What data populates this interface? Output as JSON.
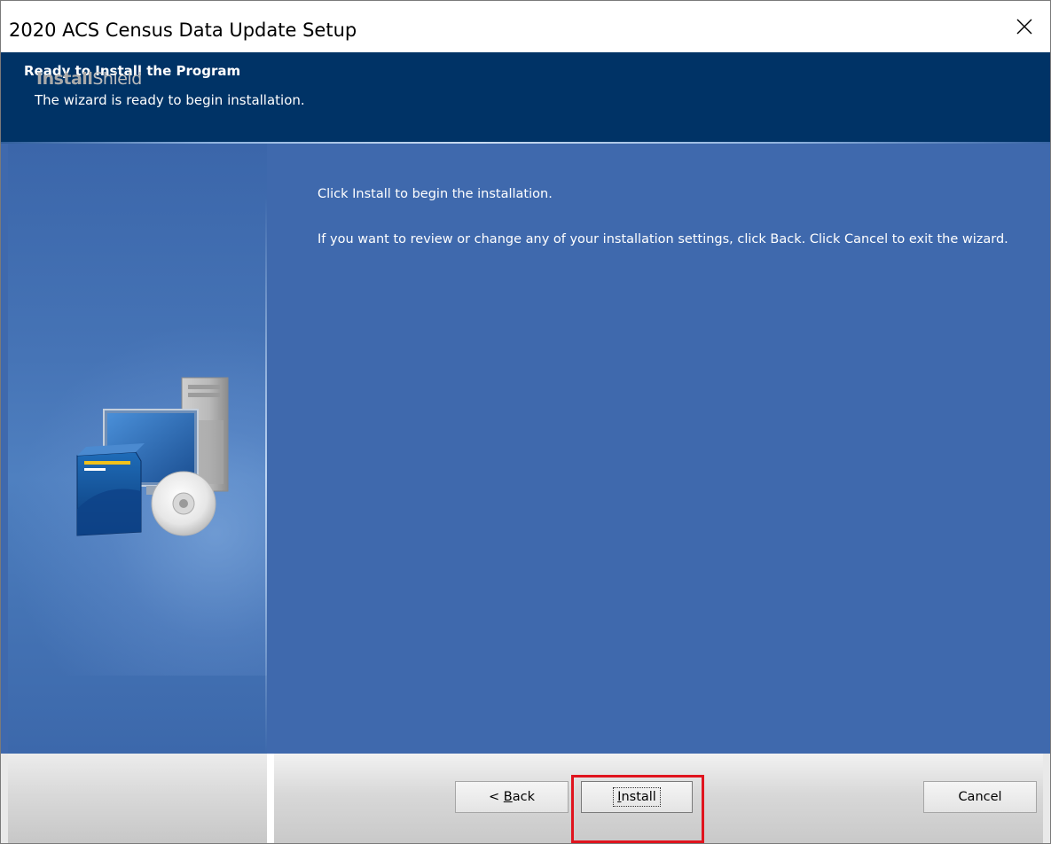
{
  "window": {
    "title": "2020 ACS Census Data Update Setup"
  },
  "header": {
    "title": "Ready to Install the Program",
    "subtitle": "The wizard is ready to begin installation."
  },
  "content": {
    "line1": "Click Install to begin the installation.",
    "line2": "If you want to review or change any of your installation settings, click Back. Click Cancel to exit the wizard."
  },
  "footer": {
    "brand_bold": "Install",
    "brand_light": "Shield",
    "buttons": {
      "back_prefix": "< ",
      "back_mnemonic": "B",
      "back_rest": "ack",
      "install_mnemonic": "I",
      "install_rest": "nstall",
      "cancel": "Cancel"
    }
  },
  "colors": {
    "header_bg": "#003366",
    "body_bg": "#3f69ad",
    "highlight": "#e0141e"
  },
  "icons": [
    "close-icon",
    "computer-setup-illustration",
    "cd-disc-icon",
    "software-box-icon",
    "tower-pc-icon",
    "monitor-icon"
  ]
}
